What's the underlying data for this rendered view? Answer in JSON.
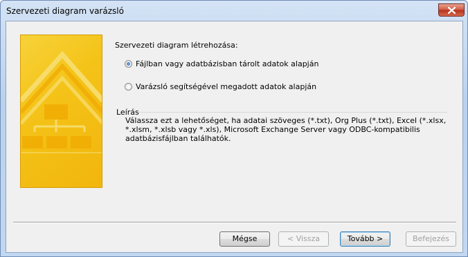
{
  "window": {
    "title": "Szervezeti diagram varázsló"
  },
  "heading": "Szervezeti diagram létrehozása:",
  "options": [
    {
      "label": "Fájlban vagy adatbázisban tárolt adatok alapján",
      "checked": true
    },
    {
      "label": "Varázsló segítségével megadott adatok alapján",
      "checked": false
    }
  ],
  "description": {
    "label": "Leírás",
    "text": "Válassza ezt a lehetőséget, ha adatai szöveges (*.txt), Org Plus (*.txt), Excel (*.xlsx, *.xlsm, *.xlsb vagy *.xls), Microsoft Exchange Server vagy ODBC-kompatibilis adatbázisfájlban találhatók."
  },
  "buttons": {
    "cancel": "Mégse",
    "back": "< Vissza",
    "next": "Tovább >",
    "finish": "Befejezés"
  },
  "colors": {
    "banner_yellow": "#f4c318",
    "banner_accent": "#f0a800"
  },
  "icons": {
    "close": "close-icon",
    "banner": "org-chart-illustration"
  }
}
